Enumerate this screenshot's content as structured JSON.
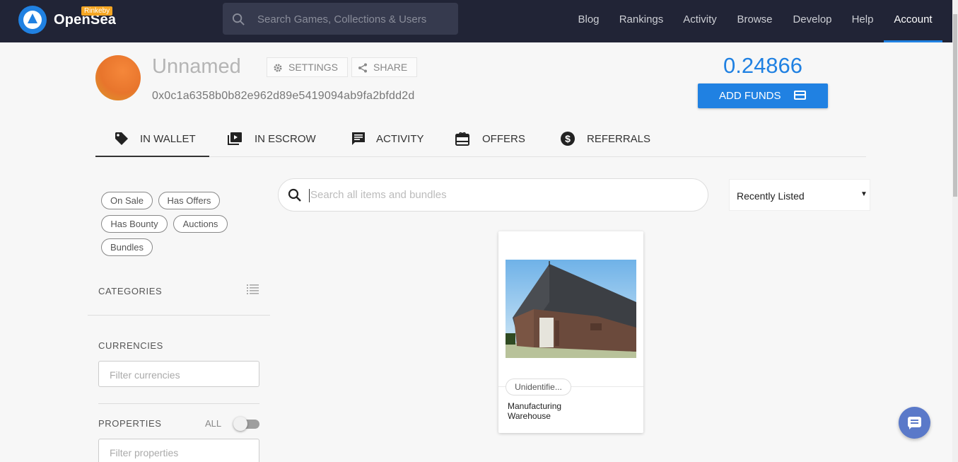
{
  "header": {
    "brand": "OpenSea",
    "network_badge": "Rinkeby",
    "search_placeholder": "Search Games, Collections & Users",
    "nav": [
      {
        "label": "Blog"
      },
      {
        "label": "Rankings"
      },
      {
        "label": "Activity"
      },
      {
        "label": "Browse"
      },
      {
        "label": "Develop"
      },
      {
        "label": "Help"
      },
      {
        "label": "Account",
        "active": true
      }
    ]
  },
  "profile": {
    "name": "Unnamed",
    "address": "0x0c1a6358b0b82e962d89e5419094ab9fa2bfdd2d",
    "settings_label": "SETTINGS",
    "share_label": "SHARE",
    "balance": "0.24866 ETH",
    "add_funds_label": "ADD FUNDS"
  },
  "tabs": [
    {
      "label": "IN WALLET",
      "icon": "tag-icon",
      "active": true
    },
    {
      "label": "IN ESCROW",
      "icon": "escrow-icon"
    },
    {
      "label": "ACTIVITY",
      "icon": "activity-icon"
    },
    {
      "label": "OFFERS",
      "icon": "offers-icon"
    },
    {
      "label": "REFERRALS",
      "icon": "dollar-icon"
    }
  ],
  "filters": {
    "chips": [
      "On Sale",
      "Has Offers",
      "Has Bounty",
      "Auctions",
      "Bundles"
    ],
    "categories_label": "CATEGORIES",
    "currencies_label": "CURRENCIES",
    "currencies_placeholder": "Filter currencies",
    "properties_label": "PROPERTIES",
    "all_label": "ALL",
    "properties_placeholder": "Filter properties"
  },
  "main": {
    "search_placeholder": "Search all items and bundles",
    "sort_value": "Recently Listed",
    "items": [
      {
        "collection": "Unidentifie...",
        "name": "Manufacturing Warehouse"
      }
    ]
  },
  "colors": {
    "nav_bg": "#212436",
    "accent": "#2081e2",
    "chat": "#5a79c9"
  }
}
